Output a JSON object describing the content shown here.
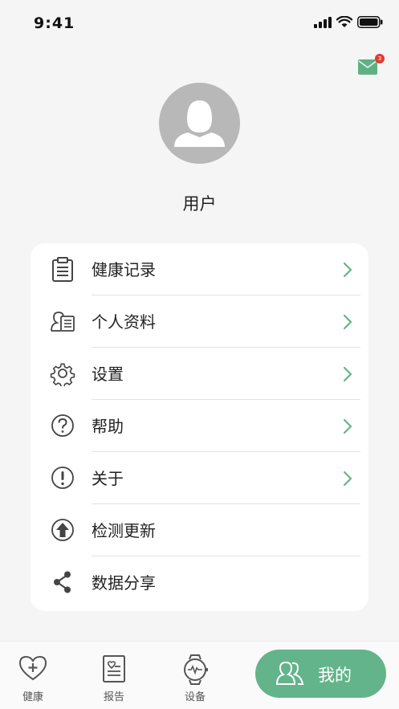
{
  "status": {
    "time": "9:41"
  },
  "header": {
    "mail_badge": "3"
  },
  "profile": {
    "username": "用户"
  },
  "menu": {
    "items": [
      {
        "label": "健康记录",
        "icon": "clipboard-icon",
        "chevron": true
      },
      {
        "label": "个人资料",
        "icon": "profile-card-icon",
        "chevron": true
      },
      {
        "label": "设置",
        "icon": "gear-icon",
        "chevron": true
      },
      {
        "label": "帮助",
        "icon": "question-icon",
        "chevron": true
      },
      {
        "label": "关于",
        "icon": "exclamation-icon",
        "chevron": true
      },
      {
        "label": "检测更新",
        "icon": "upload-arrow-icon",
        "chevron": false
      },
      {
        "label": "数据分享",
        "icon": "share-icon",
        "chevron": false
      }
    ]
  },
  "tabbar": {
    "health": "健康",
    "report": "报告",
    "device": "设备",
    "mine": "我的"
  },
  "colors": {
    "accent": "#63b48a",
    "badge": "#e53935",
    "avatar": "#b8b8b8"
  }
}
